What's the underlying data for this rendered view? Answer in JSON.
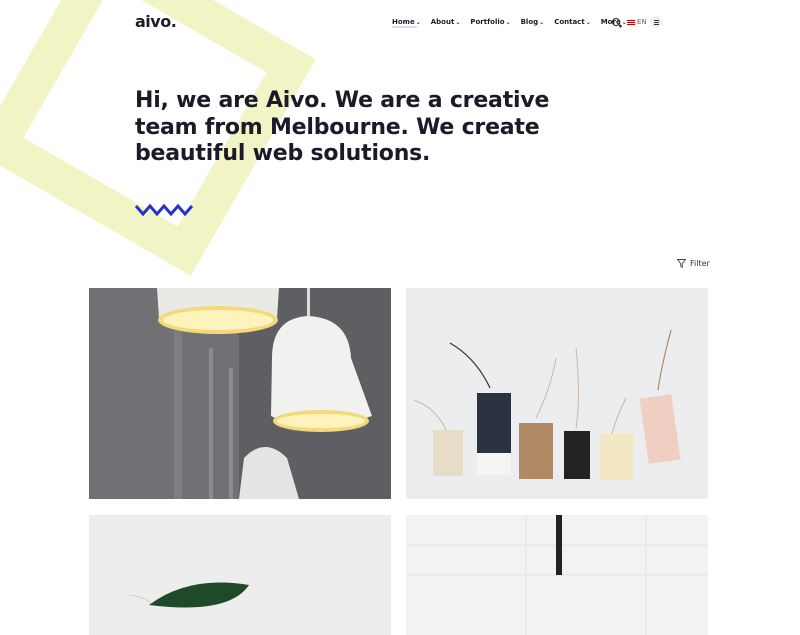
{
  "brand": {
    "logo_text": "aivo.",
    "accent_color": "#2233cc",
    "deco_color": "#f3f4c6"
  },
  "nav": {
    "items": [
      {
        "label": "Home",
        "active": true
      },
      {
        "label": "About"
      },
      {
        "label": "Portfolio"
      },
      {
        "label": "Blog"
      },
      {
        "label": "Contact"
      },
      {
        "label": "More"
      }
    ],
    "language": "EN"
  },
  "hero": {
    "title": "Hi, we are Aivo. We are a creative team from Melbourne. We create beautiful web solutions."
  },
  "portfolio": {
    "filter_label": "Filter",
    "items": [
      {
        "image": "pendant-lamps-photo"
      },
      {
        "image": "gift-tags-photo"
      },
      {
        "image": "plant-leaf-photo"
      },
      {
        "image": "white-wall-photo"
      }
    ]
  }
}
